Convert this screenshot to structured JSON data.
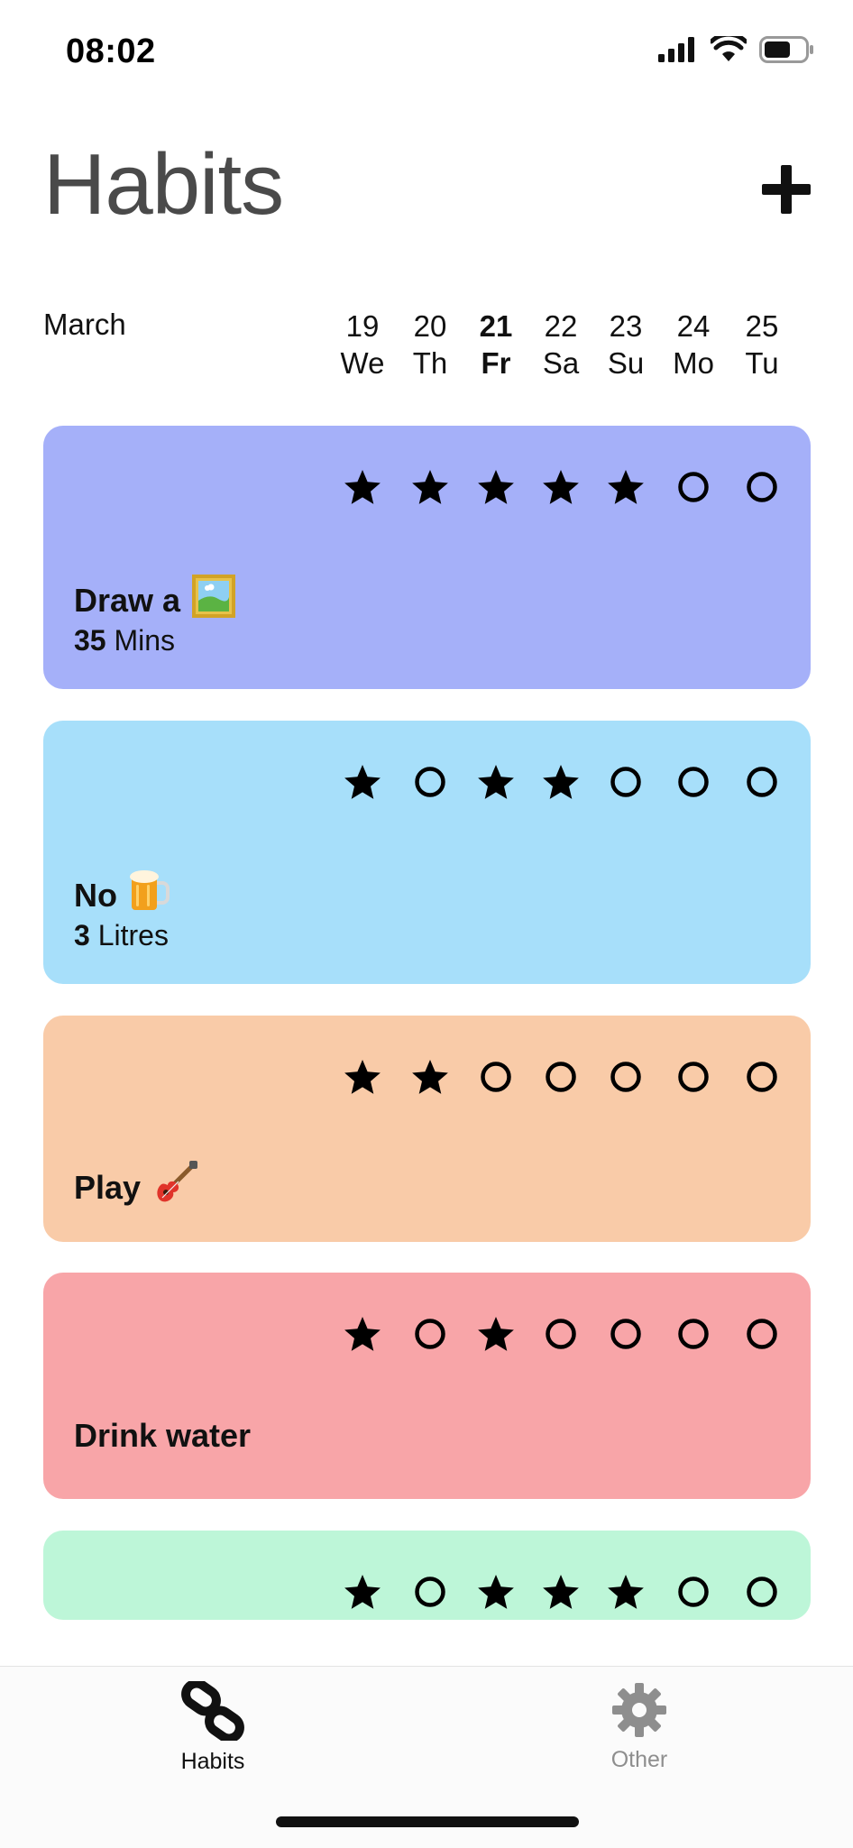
{
  "status_bar": {
    "time": "08:02",
    "icons": [
      "cellular-signal-icon",
      "wifi-icon",
      "battery-icon"
    ]
  },
  "header": {
    "title": "Habits",
    "add_icon": "plus-icon"
  },
  "calendar": {
    "month": "March",
    "days": [
      {
        "num": "19",
        "wd": "We",
        "today": false
      },
      {
        "num": "20",
        "wd": "Th",
        "today": false
      },
      {
        "num": "21",
        "wd": "Fr",
        "today": true
      },
      {
        "num": "22",
        "wd": "Sa",
        "today": false
      },
      {
        "num": "23",
        "wd": "Su",
        "today": false
      },
      {
        "num": "24",
        "wd": "Mo",
        "today": false
      },
      {
        "num": "25",
        "wd": "Tu",
        "today": false
      }
    ]
  },
  "habits": [
    {
      "name": "Draw a",
      "emoji": "picture-frame-emoji",
      "amount": "35",
      "unit": "Mins",
      "color": "#a5b0f9",
      "marks": [
        "star",
        "star",
        "star",
        "star",
        "star",
        "circle",
        "circle"
      ]
    },
    {
      "name": "No",
      "emoji": "beer-mug-emoji",
      "amount": "3",
      "unit": "Litres",
      "color": "#a7dffa",
      "marks": [
        "star",
        "circle",
        "star",
        "star",
        "circle",
        "circle",
        "circle"
      ]
    },
    {
      "name": "Play",
      "emoji": "guitar-emoji",
      "amount": "",
      "unit": "",
      "color": "#f9cba8",
      "marks": [
        "star",
        "star",
        "circle",
        "circle",
        "circle",
        "circle",
        "circle"
      ]
    },
    {
      "name": "Drink water",
      "emoji": "",
      "amount": "",
      "unit": "",
      "color": "#f8a5a8",
      "marks": [
        "star",
        "circle",
        "star",
        "circle",
        "circle",
        "circle",
        "circle"
      ]
    },
    {
      "name": "",
      "emoji": "",
      "amount": "",
      "unit": "",
      "color": "#bdf6d8",
      "marks": [
        "star",
        "circle",
        "star",
        "star",
        "star",
        "circle",
        "circle"
      ]
    }
  ],
  "tab_bar": {
    "tabs": [
      {
        "label": "Habits",
        "icon": "link-icon",
        "active": true,
        "color": "#111111"
      },
      {
        "label": "Other",
        "icon": "gear-icon",
        "active": false,
        "color": "#8e8e8e"
      }
    ]
  }
}
